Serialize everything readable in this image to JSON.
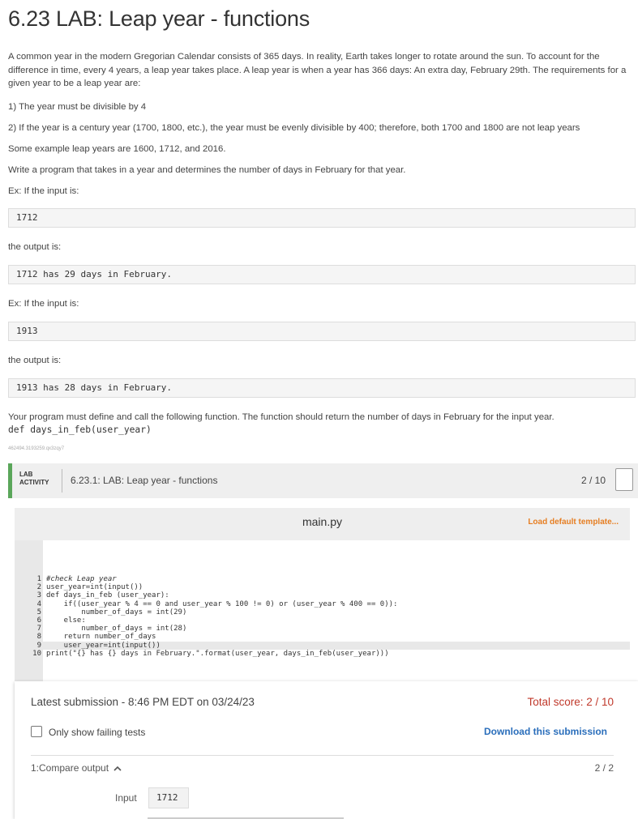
{
  "title": "6.23 LAB: Leap year - functions",
  "intro": "A common year in the modern Gregorian Calendar consists of 365 days. In reality, Earth takes longer to rotate around the sun. To account for the difference in time, every 4 years, a leap year takes place. A leap year is when a year has 366 days: An extra day, February 29th. The requirements for a given year to be a leap year are:",
  "req1": "1) The year must be divisible by 4",
  "req2": "2) If the year is a century year (1700, 1800, etc.), the year must be evenly divisible by 400; therefore, both 1700 and 1800 are not leap years",
  "examples": "Some example leap years are 1600, 1712, and 2016.",
  "task": "Write a program that takes in a year and determines the number of days in February for that year.",
  "ex1_input_label": "Ex: If the input is:",
  "ex1_input": "1712",
  "ex1_output_label": "the output is:",
  "ex1_output": "1712 has 29 days in February.",
  "ex2_input_label": "Ex: If the input is:",
  "ex2_input": "1913",
  "ex2_output_label": "the output is:",
  "ex2_output": "1913 has 28 days in February.",
  "define_text": "Your program must define and call the following function. The function should return the number of days in February for the input year.",
  "function_sig": "def days_in_feb(user_year)",
  "tiny_id": "462494.3193259.qx3zqy7",
  "lab": {
    "tag_line1": "LAB",
    "tag_line2": "ACTIVITY",
    "name": "6.23.1: LAB: Leap year - functions",
    "score": "2 / 10"
  },
  "editor": {
    "filename": "main.py",
    "load_template": "Load default template..."
  },
  "code_lines": [
    "#check Leap year",
    "user_year=int(input())",
    "def days_in_feb (user_year):",
    "    if((user_year % 4 == 0 and user_year % 100 != 0) or (user_year % 400 == 0)):",
    "        number_of_days = int(29)",
    "    else:",
    "        number_of_days = int(28)",
    "    return number_of_days",
    "    user_year=int(input())",
    "print(\"{} has {} days in February.\".format(user_year, days_in_feb(user_year)))"
  ],
  "submission": {
    "latest": "Latest submission - 8:46 PM EDT on 03/24/23",
    "total": "Total score: 2 / 10",
    "only_failing": "Only show failing tests",
    "download": "Download this submission",
    "compare": "1:Compare output",
    "compare_score": "2 / 2",
    "input_label": "Input",
    "input_value": "1712"
  }
}
